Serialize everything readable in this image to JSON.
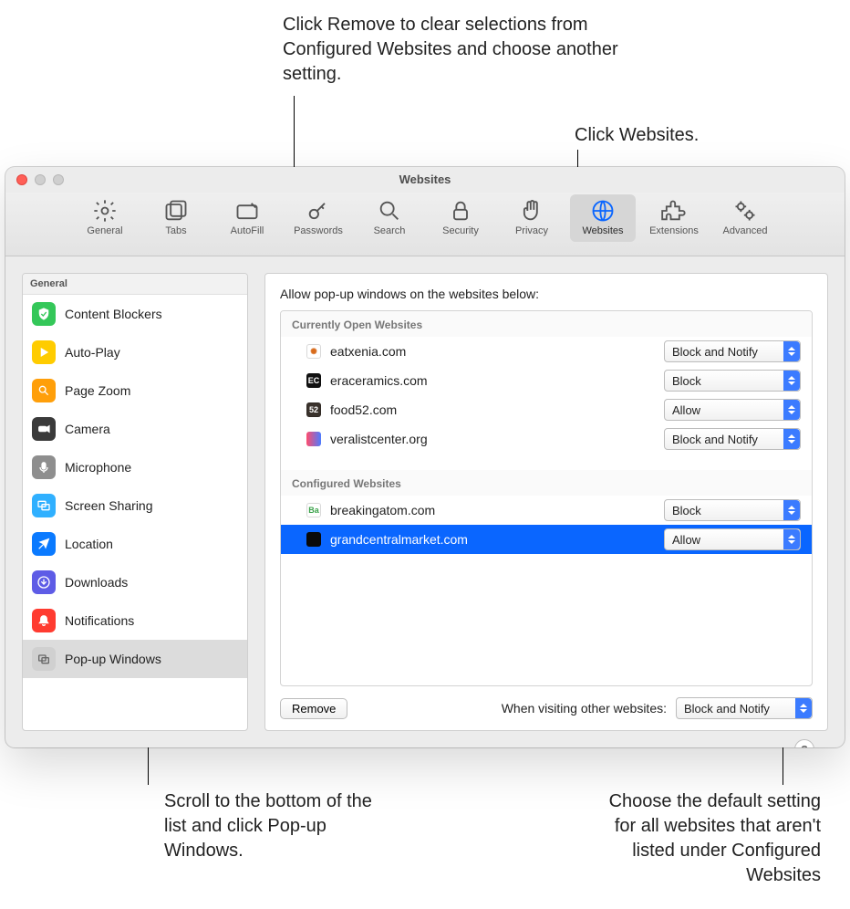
{
  "callouts": {
    "remove": "Click Remove to clear selections from Configured Websites and choose another setting.",
    "websites": "Click Websites.",
    "popup": "Scroll to the bottom of the list and click Pop-up Windows.",
    "default": "Choose the default setting for all websites that aren't listed under Configured Websites"
  },
  "window": {
    "title": "Websites"
  },
  "toolbar": {
    "items": [
      {
        "label": "General"
      },
      {
        "label": "Tabs"
      },
      {
        "label": "AutoFill"
      },
      {
        "label": "Passwords"
      },
      {
        "label": "Search"
      },
      {
        "label": "Security"
      },
      {
        "label": "Privacy"
      },
      {
        "label": "Websites"
      },
      {
        "label": "Extensions"
      },
      {
        "label": "Advanced"
      }
    ]
  },
  "sidebar": {
    "header": "General",
    "items": [
      {
        "label": "Content Blockers",
        "icon": "shield",
        "bg": "#34c759"
      },
      {
        "label": "Auto-Play",
        "icon": "play",
        "bg": "#ffcc00"
      },
      {
        "label": "Page Zoom",
        "icon": "zoom",
        "bg": "#ff9f0a"
      },
      {
        "label": "Camera",
        "icon": "camera",
        "bg": "#3a3a3a"
      },
      {
        "label": "Microphone",
        "icon": "mic",
        "bg": "#8e8e8e"
      },
      {
        "label": "Screen Sharing",
        "icon": "screens",
        "bg": "#30b0ff"
      },
      {
        "label": "Location",
        "icon": "arrow",
        "bg": "#0a7aff"
      },
      {
        "label": "Downloads",
        "icon": "download",
        "bg": "#5e5ce6"
      },
      {
        "label": "Notifications",
        "icon": "bell",
        "bg": "#ff3b30"
      },
      {
        "label": "Pop-up Windows",
        "icon": "windows",
        "bg": "#d0d0d0"
      }
    ]
  },
  "main": {
    "instruction": "Allow pop-up windows on the websites below:",
    "open_header": "Currently Open Websites",
    "open": [
      {
        "domain": "eatxenia.com",
        "setting": "Block and Notify",
        "fav_bg": "#ffffff",
        "fav_txt": "✺",
        "fav_color": "#d86b1b"
      },
      {
        "domain": "eraceramics.com",
        "setting": "Block",
        "fav_bg": "#111111",
        "fav_txt": "EC",
        "fav_color": "#ffffff"
      },
      {
        "domain": "food52.com",
        "setting": "Allow",
        "fav_bg": "#3a322c",
        "fav_txt": "52",
        "fav_color": "#ffffff"
      },
      {
        "domain": "veralistcenter.org",
        "setting": "Block and Notify",
        "fav_bg": "linear",
        "fav_txt": "",
        "fav_color": "#fff"
      }
    ],
    "conf_header": "Configured Websites",
    "configured": [
      {
        "domain": "breakingatom.com",
        "setting": "Block",
        "fav_bg": "#ffffff",
        "fav_txt": "Ba",
        "fav_color": "#3aa24a",
        "selected": false
      },
      {
        "domain": "grandcentralmarket.com",
        "setting": "Allow",
        "fav_bg": "#0a0a0a",
        "fav_txt": "▭",
        "fav_color": "#0a0a0a",
        "selected": true
      }
    ],
    "remove_label": "Remove",
    "other_label": "When visiting other websites:",
    "other_setting": "Block and Notify",
    "help": "?"
  }
}
